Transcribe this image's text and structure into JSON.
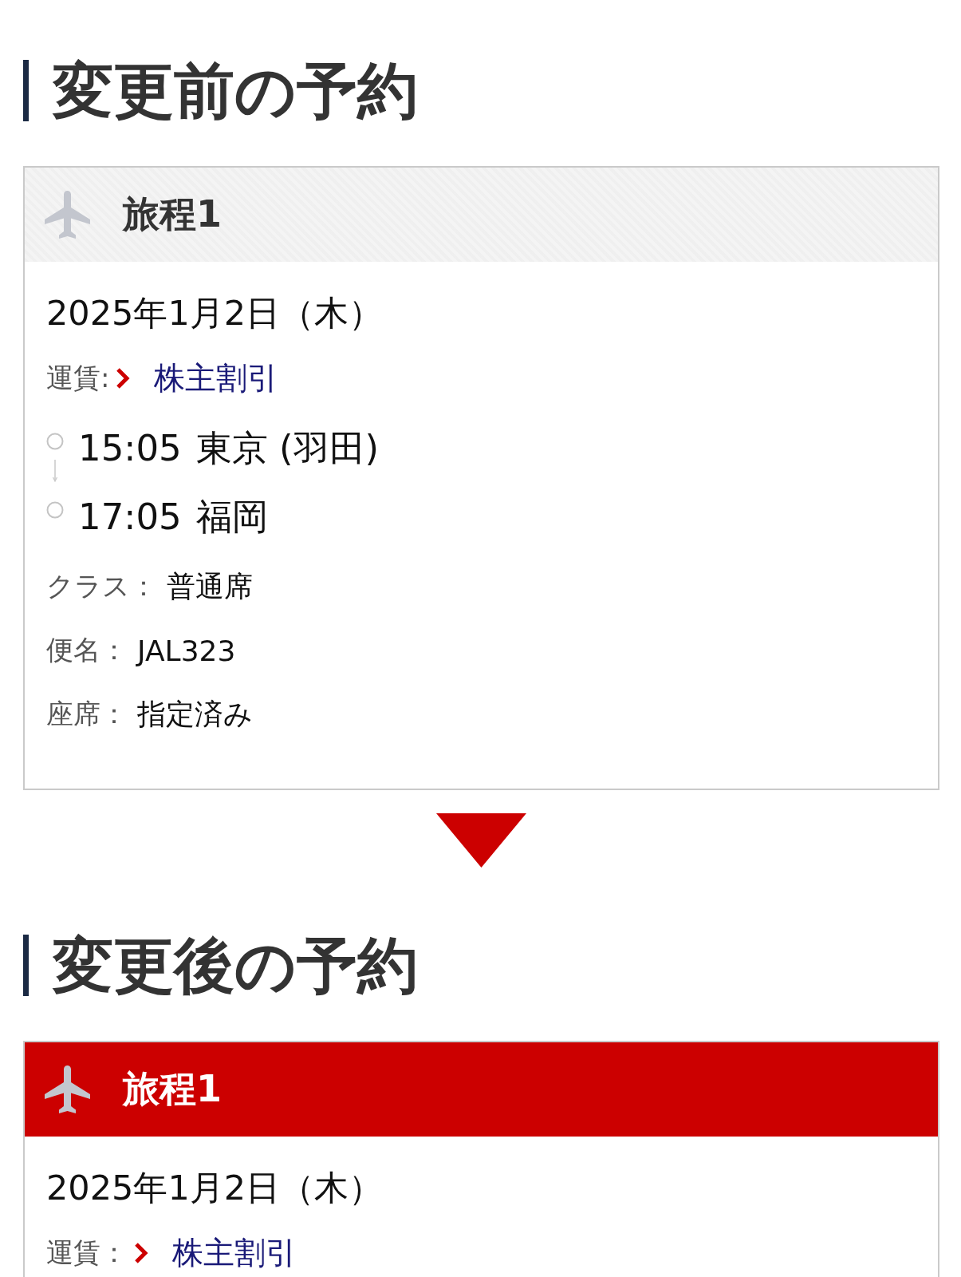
{
  "sections": [
    {
      "heading": "変更前の予約",
      "itinerary": {
        "title": "旅程1",
        "highlighted": false,
        "date": "2025年1月2日（木）",
        "fare_label": "運賃:",
        "fare": "株主割引",
        "segments": [
          {
            "time": "15:05",
            "place": "東京 (羽田)"
          },
          {
            "time": "17:05",
            "place": "福岡"
          }
        ],
        "details": [
          {
            "label": "クラス：",
            "value": "普通席"
          },
          {
            "label": "便名：",
            "value": "JAL323"
          },
          {
            "label": "座席：",
            "value": "指定済み"
          }
        ]
      }
    },
    {
      "heading": "変更後の予約",
      "itinerary": {
        "title": "旅程1",
        "highlighted": true,
        "date": "2025年1月2日（木）",
        "fare_label": "運賃：",
        "fare": "株主割引"
      }
    }
  ]
}
